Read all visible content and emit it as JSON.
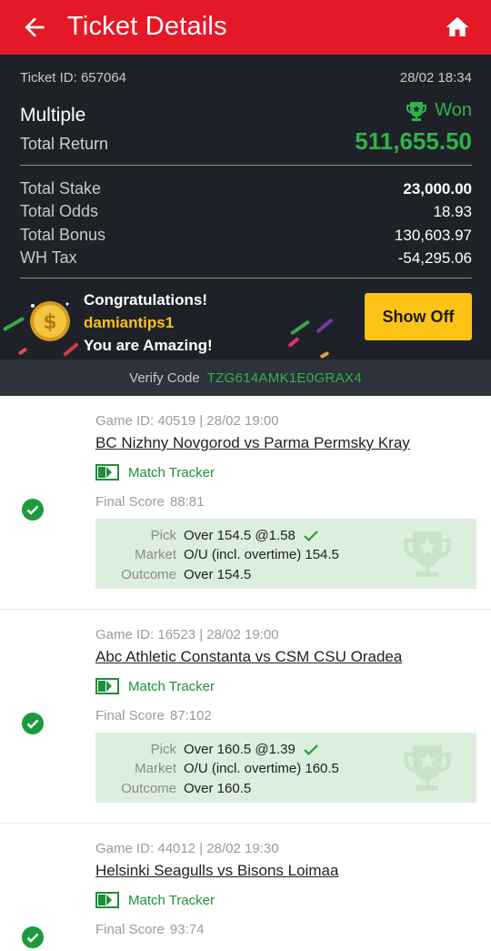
{
  "header": {
    "title": "Ticket Details"
  },
  "ticket": {
    "id_label": "Ticket ID: 657064",
    "datetime": "28/02 18:34",
    "bet_type": "Multiple",
    "status": "Won",
    "total_return_label": "Total Return",
    "total_return": "511,655.50",
    "stats": [
      {
        "label": "Total Stake",
        "value": "23,000.00"
      },
      {
        "label": "Total Odds",
        "value": "18.93"
      },
      {
        "label": "Total Bonus",
        "value": "130,603.97"
      },
      {
        "label": "WH Tax",
        "value": "-54,295.06"
      }
    ]
  },
  "congrats": {
    "line1": "Congratulations!",
    "username": "damiantips1",
    "line3": "You are Amazing!",
    "show_off_label": "Show Off"
  },
  "verify": {
    "label": "Verify Code",
    "code": "TZG614AMK1E0GRAX4"
  },
  "selections": [
    {
      "meta": "Game ID: 40519 | 28/02 19:00",
      "title": "BC Nizhny Novgorod vs Parma Permsky Kray",
      "tracker_label": "Match Tracker",
      "final_score_label": "Final Score",
      "final_score": "88:81",
      "pick_label": "Pick",
      "pick": "Over 154.5 @1.58",
      "market_label": "Market",
      "market": "O/U (incl. overtime) 154.5",
      "outcome_label": "Outcome",
      "outcome": "Over 154.5"
    },
    {
      "meta": "Game ID: 16523 | 28/02 19:00",
      "title": "Abc Athletic Constanta vs CSM CSU Oradea",
      "tracker_label": "Match Tracker",
      "final_score_label": "Final Score",
      "final_score": "87:102",
      "pick_label": "Pick",
      "pick": "Over 160.5 @1.39",
      "market_label": "Market",
      "market": "O/U (incl. overtime) 160.5",
      "outcome_label": "Outcome",
      "outcome": "Over 160.5"
    },
    {
      "meta": "Game ID: 44012 | 28/02 19:30",
      "title": "Helsinki Seagulls vs Bisons Loimaa",
      "tracker_label": "Match Tracker",
      "final_score_label": "Final Score",
      "final_score": "93:74"
    }
  ],
  "colors": {
    "brand_red": "#e41827",
    "win_green": "#2fb34a",
    "dark_bg": "#1f2129",
    "cta_yellow": "#fcc417"
  }
}
